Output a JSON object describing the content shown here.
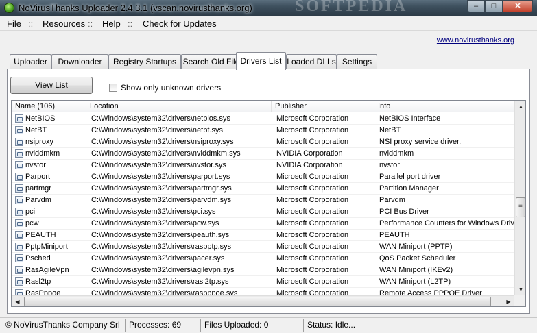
{
  "window": {
    "title": "NoVirusThanks Uploader 2.4.3.1 (vscan.novirusthanks.org)",
    "watermark": "SOFTPEDIA",
    "buttons": {
      "minimize": "–",
      "maximize": "□",
      "close": "✕"
    }
  },
  "menu": {
    "items": [
      "File",
      "Resources",
      "Help",
      "Check for Updates"
    ],
    "separator": "::"
  },
  "link": "www.novirusthanks.org",
  "tabs": [
    "Uploader",
    "Downloader",
    "Registry Startups",
    "Search Old Files",
    "Drivers List",
    "Loaded DLLs",
    "Settings"
  ],
  "active_tab": "Drivers List",
  "toolbar": {
    "view_list_label": "View List",
    "unknown_only_label": "Show only unknown drivers"
  },
  "table": {
    "columns": [
      "Name (106)",
      "Location",
      "Publisher",
      "Info"
    ],
    "rows": [
      [
        "NetBIOS",
        "C:\\Windows\\system32\\drivers\\netbios.sys",
        "Microsoft Corporation",
        "NetBIOS Interface"
      ],
      [
        "NetBT",
        "C:\\Windows\\system32\\drivers\\netbt.sys",
        "Microsoft Corporation",
        "NetBT"
      ],
      [
        "nsiproxy",
        "C:\\Windows\\system32\\drivers\\nsiproxy.sys",
        "Microsoft Corporation",
        "NSI proxy service driver."
      ],
      [
        "nvlddmkm",
        "C:\\Windows\\system32\\drivers\\nvlddmkm.sys",
        "NVIDIA Corporation",
        "nvlddmkm"
      ],
      [
        "nvstor",
        "C:\\Windows\\system32\\drivers\\nvstor.sys",
        "NVIDIA Corporation",
        "nvstor"
      ],
      [
        "Parport",
        "C:\\Windows\\system32\\drivers\\parport.sys",
        "Microsoft Corporation",
        "Parallel port driver"
      ],
      [
        "partmgr",
        "C:\\Windows\\system32\\drivers\\partmgr.sys",
        "Microsoft Corporation",
        "Partition Manager"
      ],
      [
        "Parvdm",
        "C:\\Windows\\system32\\drivers\\parvdm.sys",
        "Microsoft Corporation",
        "Parvdm"
      ],
      [
        "pci",
        "C:\\Windows\\system32\\drivers\\pci.sys",
        "Microsoft Corporation",
        "PCI Bus Driver"
      ],
      [
        "pcw",
        "C:\\Windows\\system32\\drivers\\pcw.sys",
        "Microsoft Corporation",
        "Performance Counters for Windows Drive"
      ],
      [
        "PEAUTH",
        "C:\\Windows\\system32\\drivers\\peauth.sys",
        "Microsoft Corporation",
        "PEAUTH"
      ],
      [
        "PptpMiniport",
        "C:\\Windows\\system32\\drivers\\raspptp.sys",
        "Microsoft Corporation",
        "WAN Miniport (PPTP)"
      ],
      [
        "Psched",
        "C:\\Windows\\system32\\drivers\\pacer.sys",
        "Microsoft Corporation",
        "QoS Packet Scheduler"
      ],
      [
        "RasAgileVpn",
        "C:\\Windows\\system32\\drivers\\agilevpn.sys",
        "Microsoft Corporation",
        "WAN Miniport (IKEv2)"
      ],
      [
        "Rasl2tp",
        "C:\\Windows\\system32\\drivers\\rasl2tp.sys",
        "Microsoft Corporation",
        "WAN Miniport (L2TP)"
      ],
      [
        "RasPppoe",
        "C:\\Windows\\system32\\drivers\\raspppoe.sys",
        "Microsoft Corporation",
        "Remote Access PPPOE Driver"
      ]
    ]
  },
  "statusbar": {
    "copyright": "© NoVirusThanks Company Srl",
    "processes": "Processes:  69",
    "files_uploaded": "Files Uploaded:  0",
    "status": "Status: Idle..."
  }
}
